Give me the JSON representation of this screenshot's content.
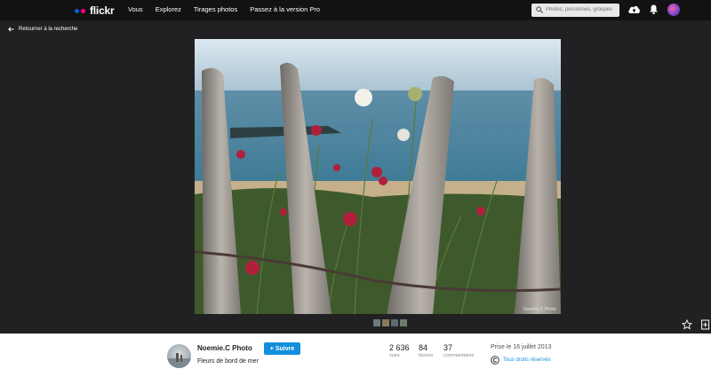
{
  "topbar": {
    "logo_text": "flickr",
    "nav": [
      "Vous",
      "Explorez",
      "Tirages photos",
      "Passez à la version Pro"
    ],
    "search_placeholder": "Photos, personnes, groupes"
  },
  "back_link": "Retourner à la recherche",
  "photo": {
    "watermark": "Noemie.C Photo"
  },
  "owner": {
    "name": "Noemie.C Photo",
    "follow_label": "+ Suivre"
  },
  "photo_title": "Fleurs de bord de mer",
  "stats": {
    "views": {
      "num": "2 636",
      "label": "vues"
    },
    "faves": {
      "num": "84",
      "label": "favoris"
    },
    "comments": {
      "num": "37",
      "label": "commentaires"
    }
  },
  "taken": "Prise le 16 juillet 2013",
  "license": "Tous droits réservés",
  "colors": {
    "accent": "#128fdc",
    "logo_blue": "#0063dc",
    "logo_pink": "#ff0084"
  }
}
